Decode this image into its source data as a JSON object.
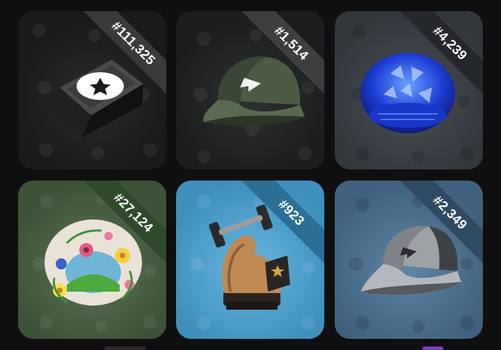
{
  "gifts": [
    {
      "number": "#111,325",
      "item_icon": "keycap-icon",
      "ribbon_color": "#3a3a3b"
    },
    {
      "number": "#1,514",
      "item_icon": "green-cap-icon",
      "ribbon_color": "#3d3e40"
    },
    {
      "number": "#4,239",
      "item_icon": "blue-crystal-hat-icon",
      "ribbon_color": "#24272b"
    },
    {
      "number": "#27,124",
      "item_icon": "flower-wreath-icon",
      "ribbon_color": "#2e4a2b"
    },
    {
      "number": "#923",
      "item_icon": "dumbbell-arm-trophy-icon",
      "ribbon_color": "#2b6f95"
    },
    {
      "number": "#2,349",
      "item_icon": "grey-cap-icon",
      "ribbon_color": "#2f4a62"
    }
  ]
}
